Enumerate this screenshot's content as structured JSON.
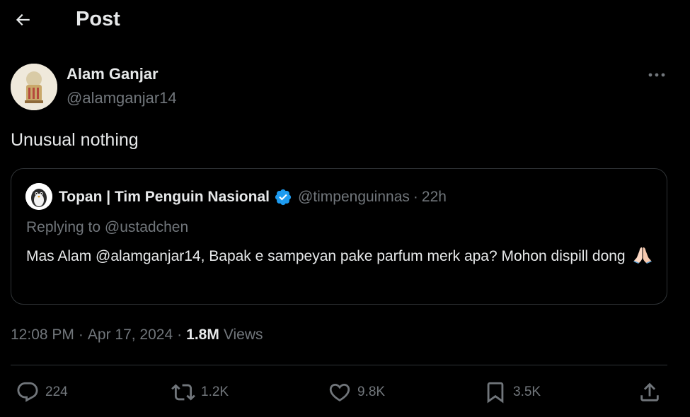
{
  "header": {
    "title": "Post"
  },
  "author": {
    "name": "Alam Ganjar",
    "handle": "@alamganjar14",
    "avatar_icon": "avatar-image"
  },
  "post": {
    "text": "Unusual nothing"
  },
  "quoted": {
    "name": "Topan | Tim Penguin Nasional",
    "verified": true,
    "handle": "@timpenguinnas",
    "separator": "·",
    "time": "22h",
    "replying_to": "Replying to @ustadchen",
    "body": "Mas Alam @alamganjar14, Bapak e sampeyan pake parfum merk apa? Mohon dispill dong",
    "emoji": "folded-hands"
  },
  "meta": {
    "time": "12:08 PM",
    "separator": "·",
    "date": "Apr 17, 2024",
    "views_count": "1.8M",
    "views_label": "Views"
  },
  "actions": {
    "replies": "224",
    "reposts": "1.2K",
    "likes": "9.8K",
    "bookmarks": "3.5K"
  },
  "colors": {
    "background": "#000000",
    "text": "#e7e9ea",
    "muted": "#71767b",
    "border": "#2f3336",
    "verified": "#1d9bf0"
  }
}
